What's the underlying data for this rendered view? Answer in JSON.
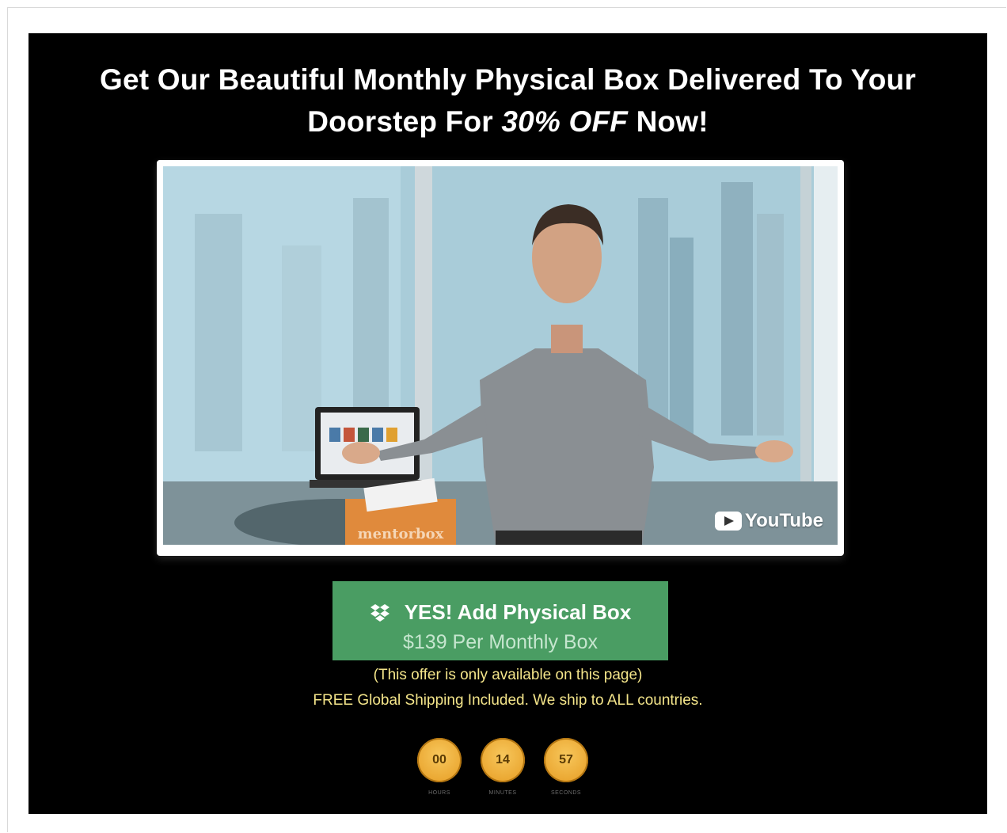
{
  "headline": {
    "line1": "Get Our Beautiful Monthly Physical Box Delivered To Your",
    "line2_prefix": "Doorstep For ",
    "line2_emphasis": "30% OFF",
    "line2_suffix": " Now!"
  },
  "video": {
    "platform": "YouTube",
    "box_brand": "mentorbox"
  },
  "cta": {
    "icon": "dropbox-icon",
    "title": "YES! Add Physical Box",
    "subtitle": "$139 Per Monthly Box",
    "color": "#4a9d63"
  },
  "notes": {
    "availability": "(This offer is only available on this page)",
    "shipping": "FREE Global Shipping Included. We ship to ALL countries."
  },
  "countdown": [
    {
      "value": "00",
      "label": "HOURS"
    },
    {
      "value": "14",
      "label": "MINUTES"
    },
    {
      "value": "57",
      "label": "SECONDS"
    }
  ],
  "colors": {
    "background": "#000000",
    "note_text": "#f4e58a",
    "timer_circle": "#eaa630"
  }
}
